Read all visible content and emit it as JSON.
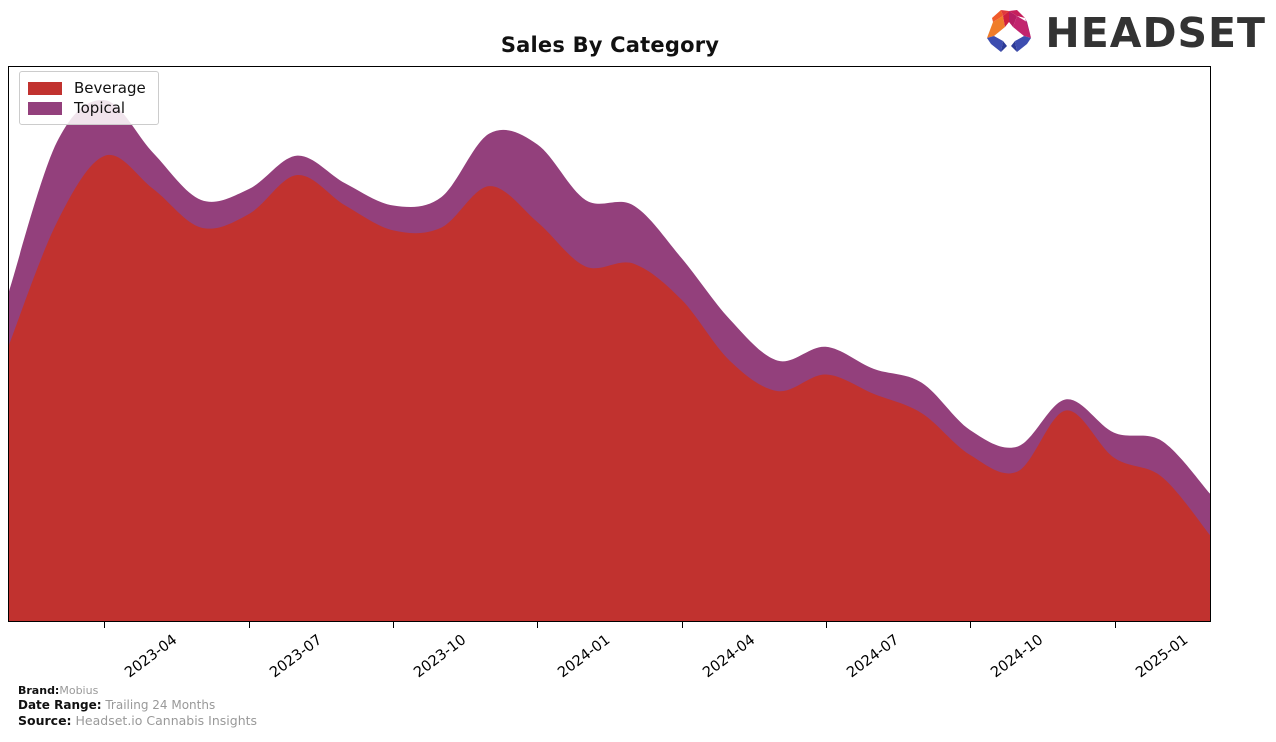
{
  "header": {
    "title": "Sales By Category",
    "logo_text": "HEADSET",
    "logo_icon": "headset-arc-logo"
  },
  "legend": {
    "position": "upper-left",
    "items": [
      {
        "label": "Beverage",
        "color": "#c1322f"
      },
      {
        "label": "Topical",
        "color": "#93407c"
      }
    ]
  },
  "footer": {
    "rows": [
      {
        "key": "Brand:",
        "value": "Mobius"
      },
      {
        "key": "Date Range:",
        "value": "Trailing 24 Months"
      },
      {
        "key": "Source:",
        "value": "Headset.io Cannabis Insights"
      }
    ]
  },
  "chart_data": {
    "type": "area",
    "stacked": true,
    "smoothed": true,
    "title": "Sales By Category",
    "xlabel": "",
    "ylabel": "",
    "grid": false,
    "legend_position": "upper left",
    "y_axis_visible": false,
    "ylim": [
      0,
      100
    ],
    "x": [
      "2023-02",
      "2023-03",
      "2023-04",
      "2023-05",
      "2023-06",
      "2023-07",
      "2023-08",
      "2023-09",
      "2023-10",
      "2023-11",
      "2023-12",
      "2024-01",
      "2024-02",
      "2024-03",
      "2024-04",
      "2024-05",
      "2024-06",
      "2024-07",
      "2024-08",
      "2024-09",
      "2024-10",
      "2024-11",
      "2024-12",
      "2025-01"
    ],
    "tick_labels": [
      "2023-04",
      "2023-07",
      "2023-10",
      "2024-01",
      "2024-04",
      "2024-07",
      "2024-10",
      "2025-01"
    ],
    "tick_positions": [
      "2023-04",
      "2023-07",
      "2023-10",
      "2024-01",
      "2024-04",
      "2024-07",
      "2024-10",
      "2025-01"
    ],
    "series": [
      {
        "name": "Beverage",
        "color": "#c1322f",
        "values": [
          49.8,
          72.0,
          84.0,
          78.0,
          71.0,
          73.5,
          80.5,
          75.0,
          70.5,
          71.0,
          78.5,
          72.0,
          64.0,
          64.5,
          58.0,
          47.0,
          41.5,
          44.5,
          41.0,
          37.5,
          30.0,
          27.0,
          38.0,
          29.5,
          26.0,
          15.5
        ]
      },
      {
        "name": "Topical",
        "color": "#93407c",
        "values": [
          9.7,
          14.5,
          10.0,
          6.5,
          5.0,
          4.5,
          3.5,
          4.0,
          4.5,
          5.5,
          9.5,
          14.0,
          12.0,
          10.5,
          7.5,
          7.5,
          5.5,
          5.0,
          4.5,
          5.5,
          4.5,
          4.5,
          2.0,
          4.5,
          6.5,
          7.5
        ]
      }
    ],
    "totals": [
      59.5,
      86.5,
      94.0,
      84.5,
      76.0,
      78.0,
      84.0,
      79.0,
      75.0,
      76.5,
      88.0,
      86.0,
      76.0,
      75.0,
      65.5,
      54.5,
      47.0,
      49.5,
      45.5,
      43.0,
      34.5,
      31.5,
      40.0,
      34.0,
      32.5,
      23.0
    ]
  }
}
